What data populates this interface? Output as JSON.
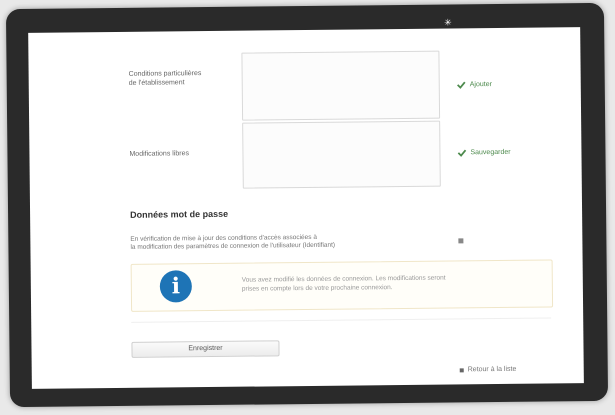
{
  "form": {
    "field1_label": "Conditions particulières",
    "field1_sublabel": "de l'établissement",
    "field1_link": "Ajouter",
    "field2_label": "Modifications libres",
    "field2_link": "Sauvegarder",
    "section_title": "Données mot de passe",
    "section_desc_line1": "En vérification de mise à jour des conditions d'accès associées à",
    "section_desc_line2": "la modification des paramètres de connexion de l'utilisateur (Identifiant)",
    "info_line1": "Vous avez modifié les données de connexion. Les modifications seront",
    "info_line2": "prises en compte lors de votre prochaine connexion.",
    "submit_label": "Enregistrer",
    "footer_link": "Retour à la liste"
  },
  "colors": {
    "accent_green": "#4d8a4d",
    "info_blue": "#1e74b6"
  }
}
